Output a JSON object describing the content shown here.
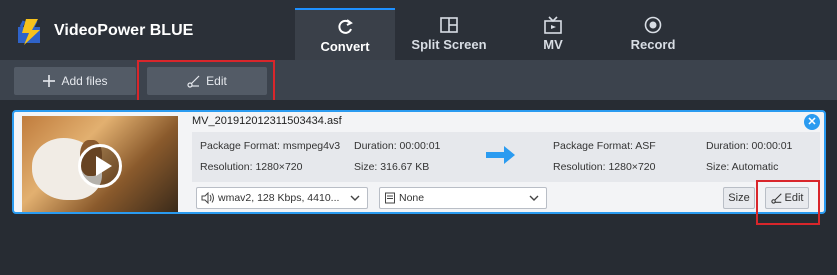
{
  "app": {
    "title": "VideoPower BLUE"
  },
  "tabs": [
    {
      "label": "Convert",
      "icon": "refresh-icon",
      "active": true
    },
    {
      "label": "Split Screen",
      "icon": "split-screen-icon",
      "active": false
    },
    {
      "label": "MV",
      "icon": "tv-icon",
      "active": false
    },
    {
      "label": "Record",
      "icon": "record-icon",
      "active": false
    }
  ],
  "toolbar": {
    "add_files_label": "Add files",
    "edit_label": "Edit"
  },
  "file": {
    "name": "MV_20191201231150343​4.asf",
    "source": {
      "package_format": "Package Format: msmpeg4v3",
      "duration": "Duration: 00:00:01",
      "resolution": "Resolution: 1280×720",
      "size": "Size: 316.67 KB"
    },
    "target": {
      "package_format": "Package Format: ASF",
      "duration": "Duration: 00:00:01",
      "resolution": "Resolution: 1280×720",
      "size": "Size: Automatic"
    },
    "audio_select": "wmav2, 128 Kbps, 4410...",
    "subtitle_select": "None",
    "size_button": "Size",
    "edit_button": "Edit"
  },
  "colors": {
    "accent": "#2a9bf0",
    "highlight": "#d9262b"
  }
}
